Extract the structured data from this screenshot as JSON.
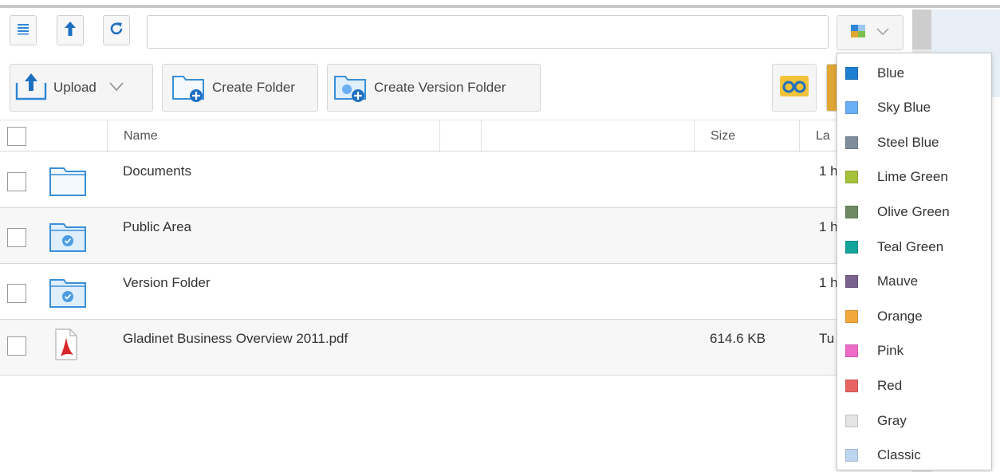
{
  "toolbar": {
    "address_value": "",
    "upload_label": "Upload",
    "create_folder_label": "Create Folder",
    "create_version_folder_label": "Create Version Folder"
  },
  "table": {
    "headers": {
      "name": "Name",
      "size": "Size",
      "modified": "La"
    },
    "rows": [
      {
        "name": "Documents",
        "size": "",
        "modified": "1 h",
        "icon": "folder-icon"
      },
      {
        "name": "Public Area",
        "size": "",
        "modified": "1 h",
        "icon": "shared-folder-icon"
      },
      {
        "name": "Version Folder",
        "size": "",
        "modified": "1 h",
        "icon": "version-folder-icon"
      },
      {
        "name": "Gladinet Business Overview 2011.pdf",
        "size": "614.6 KB",
        "modified": "Tu",
        "icon": "pdf-icon"
      }
    ]
  },
  "theme_menu": {
    "items": [
      {
        "label": "Blue",
        "color": "#1f7fd1"
      },
      {
        "label": "Sky Blue",
        "color": "#6aaef5"
      },
      {
        "label": "Steel Blue",
        "color": "#7f8e9c"
      },
      {
        "label": "Lime Green",
        "color": "#a6c33b"
      },
      {
        "label": "Olive Green",
        "color": "#6d8a62"
      },
      {
        "label": "Teal Green",
        "color": "#13a59b"
      },
      {
        "label": "Mauve",
        "color": "#7a628e"
      },
      {
        "label": "Orange",
        "color": "#f2a93b"
      },
      {
        "label": "Pink",
        "color": "#ef6bc9"
      },
      {
        "label": "Red",
        "color": "#e86464"
      },
      {
        "label": "Gray",
        "color": "#e4e4e4"
      },
      {
        "label": "Classic",
        "color": "#bdd6f0"
      }
    ]
  },
  "colors": {
    "accent": "#1f7fd1",
    "icon_blue": "#3a8fd8"
  }
}
